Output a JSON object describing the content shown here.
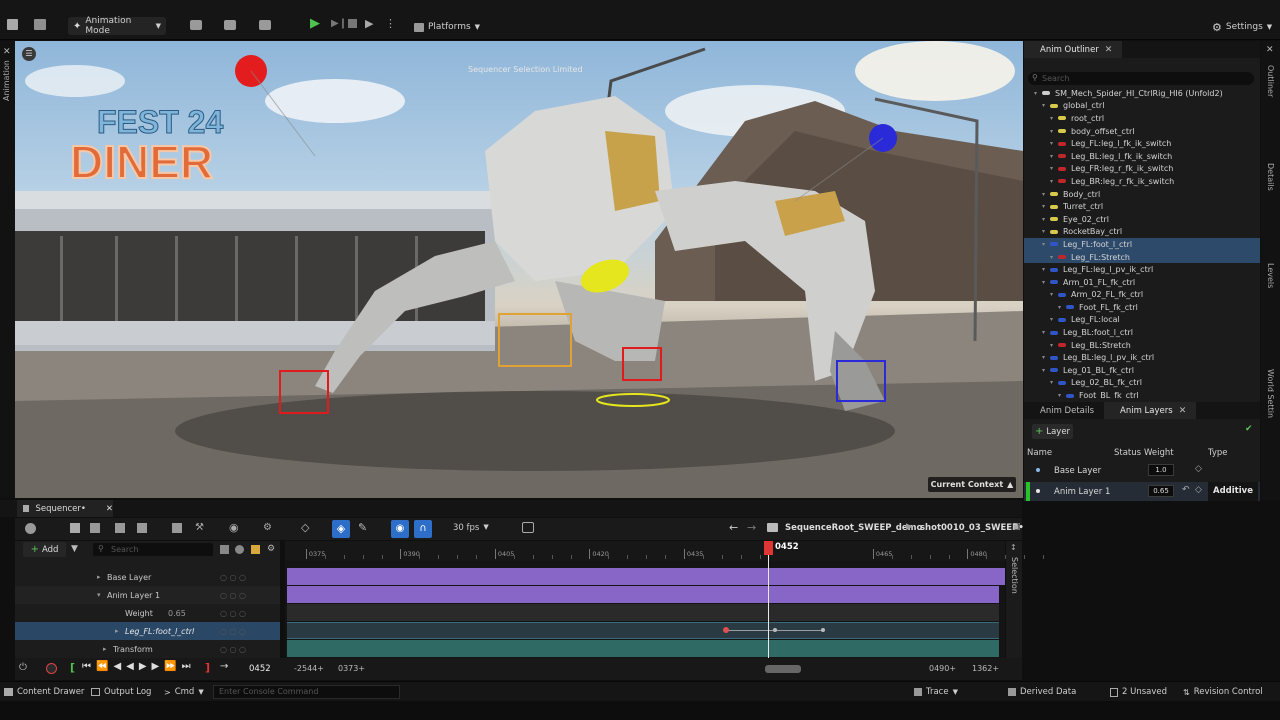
{
  "toolbar": {
    "mode_label": "Animation Mode",
    "platforms_label": "Platforms",
    "settings_label": "Settings"
  },
  "left_strip": {
    "label": "Animation"
  },
  "viewport": {
    "overlay_label": "Sequencer Selection Limited",
    "current_context_label": "Current Context",
    "diner_sign_line1": "FEST 24",
    "diner_sign_line2": "DINER"
  },
  "outliner": {
    "tab_label": "Anim Outliner",
    "search_placeholder": "Search",
    "items": [
      {
        "label": "SM_Mech_Spider_HI_CtrlRig_HI6  (Unfold2)",
        "indent": 0,
        "color": "#cccccc"
      },
      {
        "label": "global_ctrl",
        "indent": 1,
        "color": "#d9c94a"
      },
      {
        "label": "root_ctrl",
        "indent": 2,
        "color": "#d9c94a"
      },
      {
        "label": "body_offset_ctrl",
        "indent": 2,
        "color": "#d9c94a"
      },
      {
        "label": "Leg_FL:leg_l_fk_ik_switch",
        "indent": 2,
        "color": "#c0262a"
      },
      {
        "label": "Leg_BL:leg_l_fk_ik_switch",
        "indent": 2,
        "color": "#c0262a"
      },
      {
        "label": "Leg_FR:leg_r_fk_ik_switch",
        "indent": 2,
        "color": "#c0262a"
      },
      {
        "label": "Leg_BR:leg_r_fk_ik_switch",
        "indent": 2,
        "color": "#c0262a"
      },
      {
        "label": "Body_ctrl",
        "indent": 1,
        "color": "#d9c94a"
      },
      {
        "label": "Turret_ctrl",
        "indent": 1,
        "color": "#d9c94a"
      },
      {
        "label": "Eye_02_ctrl",
        "indent": 1,
        "color": "#d9c94a"
      },
      {
        "label": "RocketBay_ctrl",
        "indent": 1,
        "color": "#d9c94a"
      },
      {
        "label": "Leg_FL:foot_l_ctrl",
        "indent": 1,
        "color": "#2f55c8",
        "selected": true
      },
      {
        "label": "Leg_FL:Stretch",
        "indent": 2,
        "color": "#c0262a",
        "selected": true
      },
      {
        "label": "Leg_FL:leg_l_pv_ik_ctrl",
        "indent": 1,
        "color": "#2f55c8"
      },
      {
        "label": "Arm_01_FL_fk_ctrl",
        "indent": 1,
        "color": "#2f55c8"
      },
      {
        "label": "Arm_02_FL_fk_ctrl",
        "indent": 2,
        "color": "#2f55c8"
      },
      {
        "label": "Foot_FL_fk_ctrl",
        "indent": 3,
        "color": "#2f55c8"
      },
      {
        "label": "Leg_FL:local",
        "indent": 2,
        "color": "#2f55c8"
      },
      {
        "label": "Leg_BL:foot_l_ctrl",
        "indent": 1,
        "color": "#2f55c8"
      },
      {
        "label": "Leg_BL:Stretch",
        "indent": 2,
        "color": "#c0262a"
      },
      {
        "label": "Leg_BL:leg_l_pv_ik_ctrl",
        "indent": 1,
        "color": "#2f55c8"
      },
      {
        "label": "Leg_01_BL_fk_ctrl",
        "indent": 1,
        "color": "#2f55c8"
      },
      {
        "label": "Leg_02_BL_fk_ctrl",
        "indent": 2,
        "color": "#2f55c8"
      },
      {
        "label": "Foot_BL_fk_ctrl",
        "indent": 3,
        "color": "#2f55c8"
      }
    ]
  },
  "anim_panel": {
    "tab_details": "Anim Details",
    "tab_layers": "Anim Layers",
    "add_layer_label": "Layer",
    "headers": {
      "name": "Name",
      "status": "Status",
      "weight": "Weight",
      "type": "Type"
    },
    "layers": [
      {
        "name": "Base Layer",
        "weight": "1.0",
        "type": ""
      },
      {
        "name": "Anim Layer 1",
        "weight": "0.65",
        "type": "Additive"
      }
    ]
  },
  "right_strip": {
    "labels": [
      "Outliner",
      "Details",
      "Levels",
      "World Settin"
    ]
  },
  "sequencer": {
    "tab_label": "Sequencer•",
    "fps_label": "30 fps",
    "breadcrumb_root": "SequenceRoot_SWEEP_demo",
    "breadcrumb_shot": "shot0010_03_SWEEP•",
    "add_label": "Add",
    "search_placeholder": "Search",
    "current_frame": "0452",
    "ruler_ticks": [
      {
        "label": "0375",
        "frame": 375
      },
      {
        "label": "0390",
        "frame": 390
      },
      {
        "label": "0405",
        "frame": 405
      },
      {
        "label": "0420",
        "frame": 420
      },
      {
        "label": "0435",
        "frame": 435
      },
      {
        "label": "0465",
        "frame": 465
      },
      {
        "label": "0480",
        "frame": 480
      }
    ],
    "tracks": [
      {
        "label": "Base Layer",
        "indent": 92
      },
      {
        "label": "Anim Layer 1",
        "indent": 92
      },
      {
        "label": "Weight",
        "indent": 110,
        "value": "0.65"
      },
      {
        "label": "Leg_FL:foot_l_ctrl",
        "indent": 110,
        "selected": true
      },
      {
        "label": "Transform",
        "indent": 98
      }
    ],
    "selection_label": "Selection",
    "transport": {
      "frame": "0452",
      "range_start": "-2544+",
      "range_view_start": "0373+",
      "range_view_end": "0490+",
      "range_end": "1362+"
    }
  },
  "statusbar": {
    "content_drawer": "Content Drawer",
    "output_log": "Output Log",
    "cmd": "Cmd",
    "console_placeholder": "Enter Console Command",
    "trace": "Trace",
    "derived_data": "Derived Data",
    "unsaved": "2 Unsaved",
    "revision_control": "Revision Control"
  },
  "colors": {
    "accent_blue": "#2d6ec9",
    "layer_purple": "#8866c7",
    "track_teal": "#2f6b64",
    "playhead_red": "#e03535",
    "selected_row": "#2e4a6a"
  }
}
